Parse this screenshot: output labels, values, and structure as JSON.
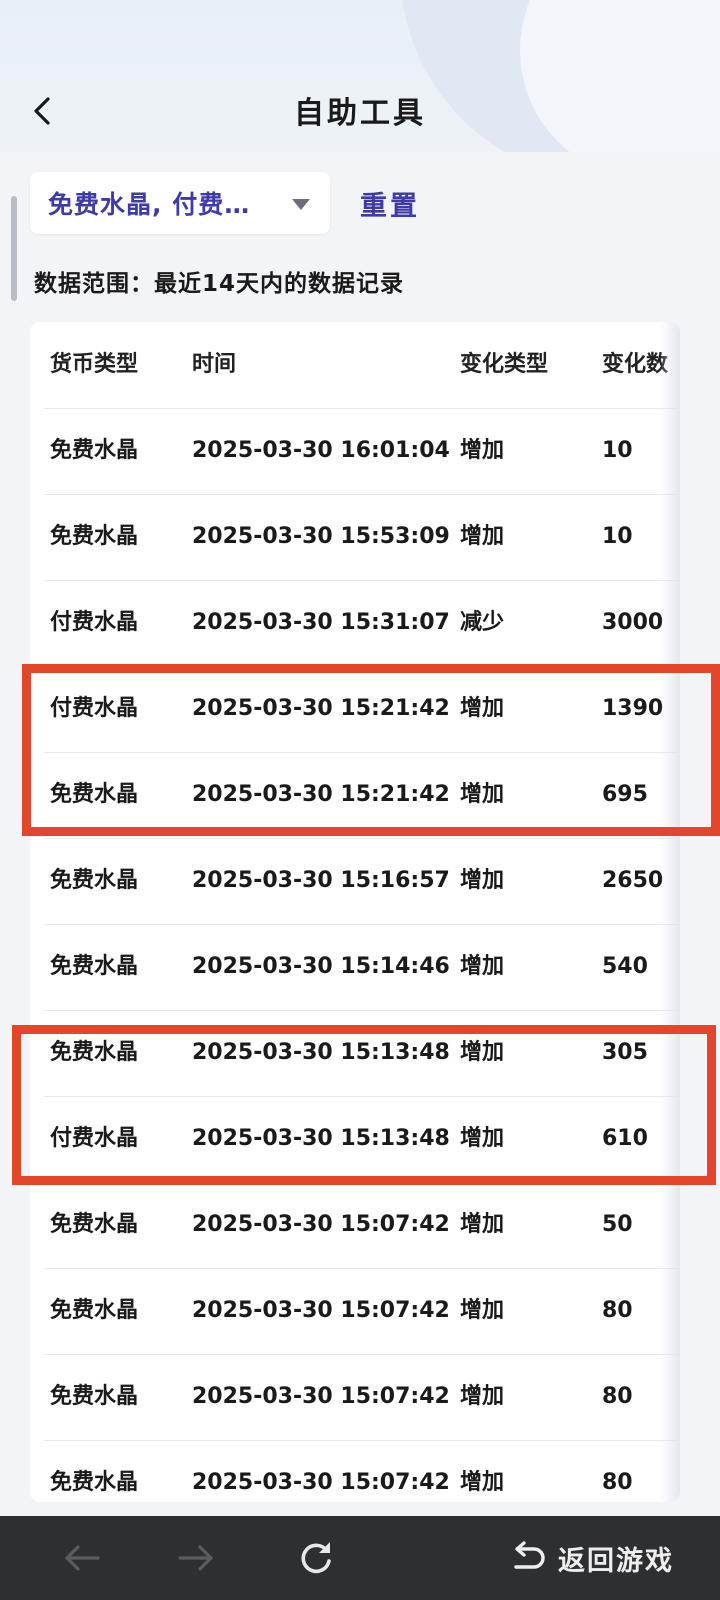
{
  "header": {
    "title": "自助工具"
  },
  "filter": {
    "selected": "免费水晶, 付费…",
    "reset_label": "重置"
  },
  "data_range": "数据范围：最近14天内的数据记录",
  "table": {
    "columns": [
      "货币类型",
      "时间",
      "变化类型",
      "变化数"
    ],
    "rows": [
      [
        "免费水晶",
        "2025-03-30 16:01:04",
        "增加",
        "10"
      ],
      [
        "免费水晶",
        "2025-03-30 15:53:09",
        "增加",
        "10"
      ],
      [
        "付费水晶",
        "2025-03-30 15:31:07",
        "减少",
        "3000"
      ],
      [
        "付费水晶",
        "2025-03-30 15:21:42",
        "增加",
        "1390"
      ],
      [
        "免费水晶",
        "2025-03-30 15:21:42",
        "增加",
        "695"
      ],
      [
        "免费水晶",
        "2025-03-30 15:16:57",
        "增加",
        "2650"
      ],
      [
        "免费水晶",
        "2025-03-30 15:14:46",
        "增加",
        "540"
      ],
      [
        "免费水晶",
        "2025-03-30 15:13:48",
        "增加",
        "305"
      ],
      [
        "付费水晶",
        "2025-03-30 15:13:48",
        "增加",
        "610"
      ],
      [
        "免费水晶",
        "2025-03-30 15:07:42",
        "增加",
        "50"
      ],
      [
        "免费水晶",
        "2025-03-30 15:07:42",
        "增加",
        "80"
      ],
      [
        "免费水晶",
        "2025-03-30 15:07:42",
        "增加",
        "80"
      ],
      [
        "免费水晶",
        "2025-03-30 15:07:42",
        "增加",
        "80"
      ]
    ]
  },
  "bottom_nav": {
    "return_label": "返回游戏"
  },
  "icons": {
    "back": "chevron-left-icon",
    "caret": "caret-down-icon",
    "prev": "arrow-left-icon",
    "next": "arrow-right-icon",
    "refresh": "refresh-icon",
    "return": "return-icon"
  },
  "colors": {
    "accent": "#3e3aa8",
    "highlight": "#e2472b",
    "bottom_bar": "#2e2f31"
  }
}
